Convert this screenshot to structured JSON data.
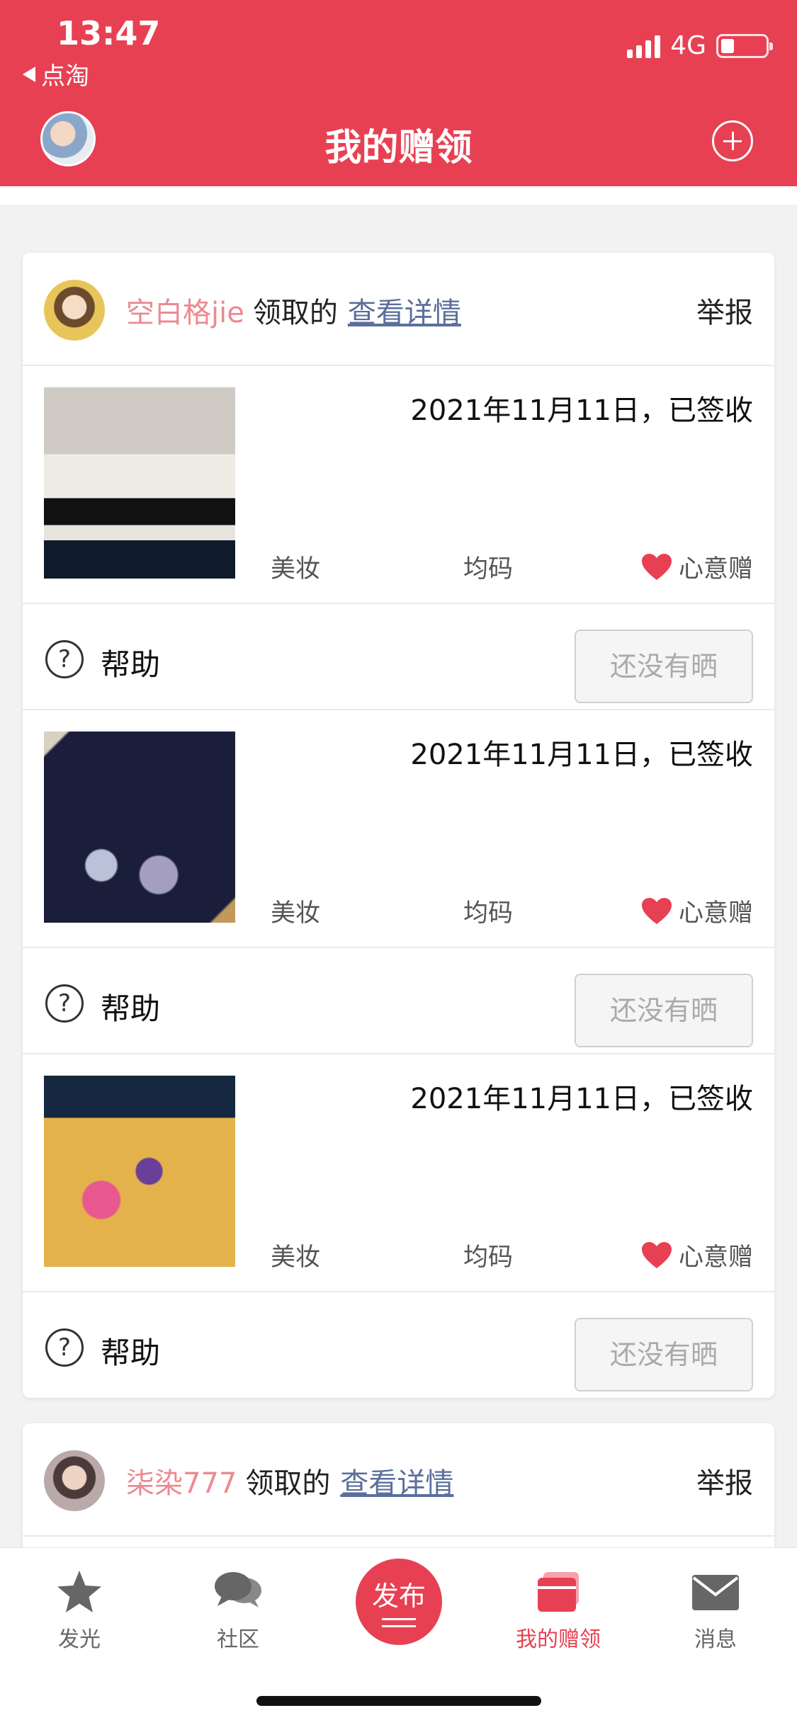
{
  "status_bar": {
    "time": "13:47",
    "back_app": "点淘",
    "network": "4G"
  },
  "header": {
    "title": "我的赠领"
  },
  "cards": [
    {
      "user": "空白格jie",
      "claimed_text": "领取的",
      "detail_link": "查看详情",
      "report": "举报",
      "items": [
        {
          "date": "2021年11月11日，已签收",
          "category": "美妆",
          "size": "均码",
          "gift_type": "心意赠",
          "help": "帮助",
          "share_button": "还没有晒"
        },
        {
          "date": "2021年11月11日，已签收",
          "category": "美妆",
          "size": "均码",
          "gift_type": "心意赠",
          "help": "帮助",
          "share_button": "还没有晒"
        },
        {
          "date": "2021年11月11日，已签收",
          "category": "美妆",
          "size": "均码",
          "gift_type": "心意赠",
          "help": "帮助",
          "share_button": "还没有晒"
        }
      ]
    },
    {
      "user": "柒染777",
      "claimed_text": "领取的",
      "detail_link": "查看详情",
      "report": "举报"
    }
  ],
  "tabbar": {
    "items": [
      {
        "label": "发光",
        "icon": "star-icon"
      },
      {
        "label": "社区",
        "icon": "chat-icon"
      },
      {
        "label": "发布",
        "icon": "publish-icon"
      },
      {
        "label": "我的赠领",
        "icon": "gift-box-icon",
        "active": true
      },
      {
        "label": "消息",
        "icon": "mail-icon"
      }
    ]
  },
  "colors": {
    "brand": "#e84053",
    "username": "#eb8a90",
    "link": "#5b6f9b"
  }
}
